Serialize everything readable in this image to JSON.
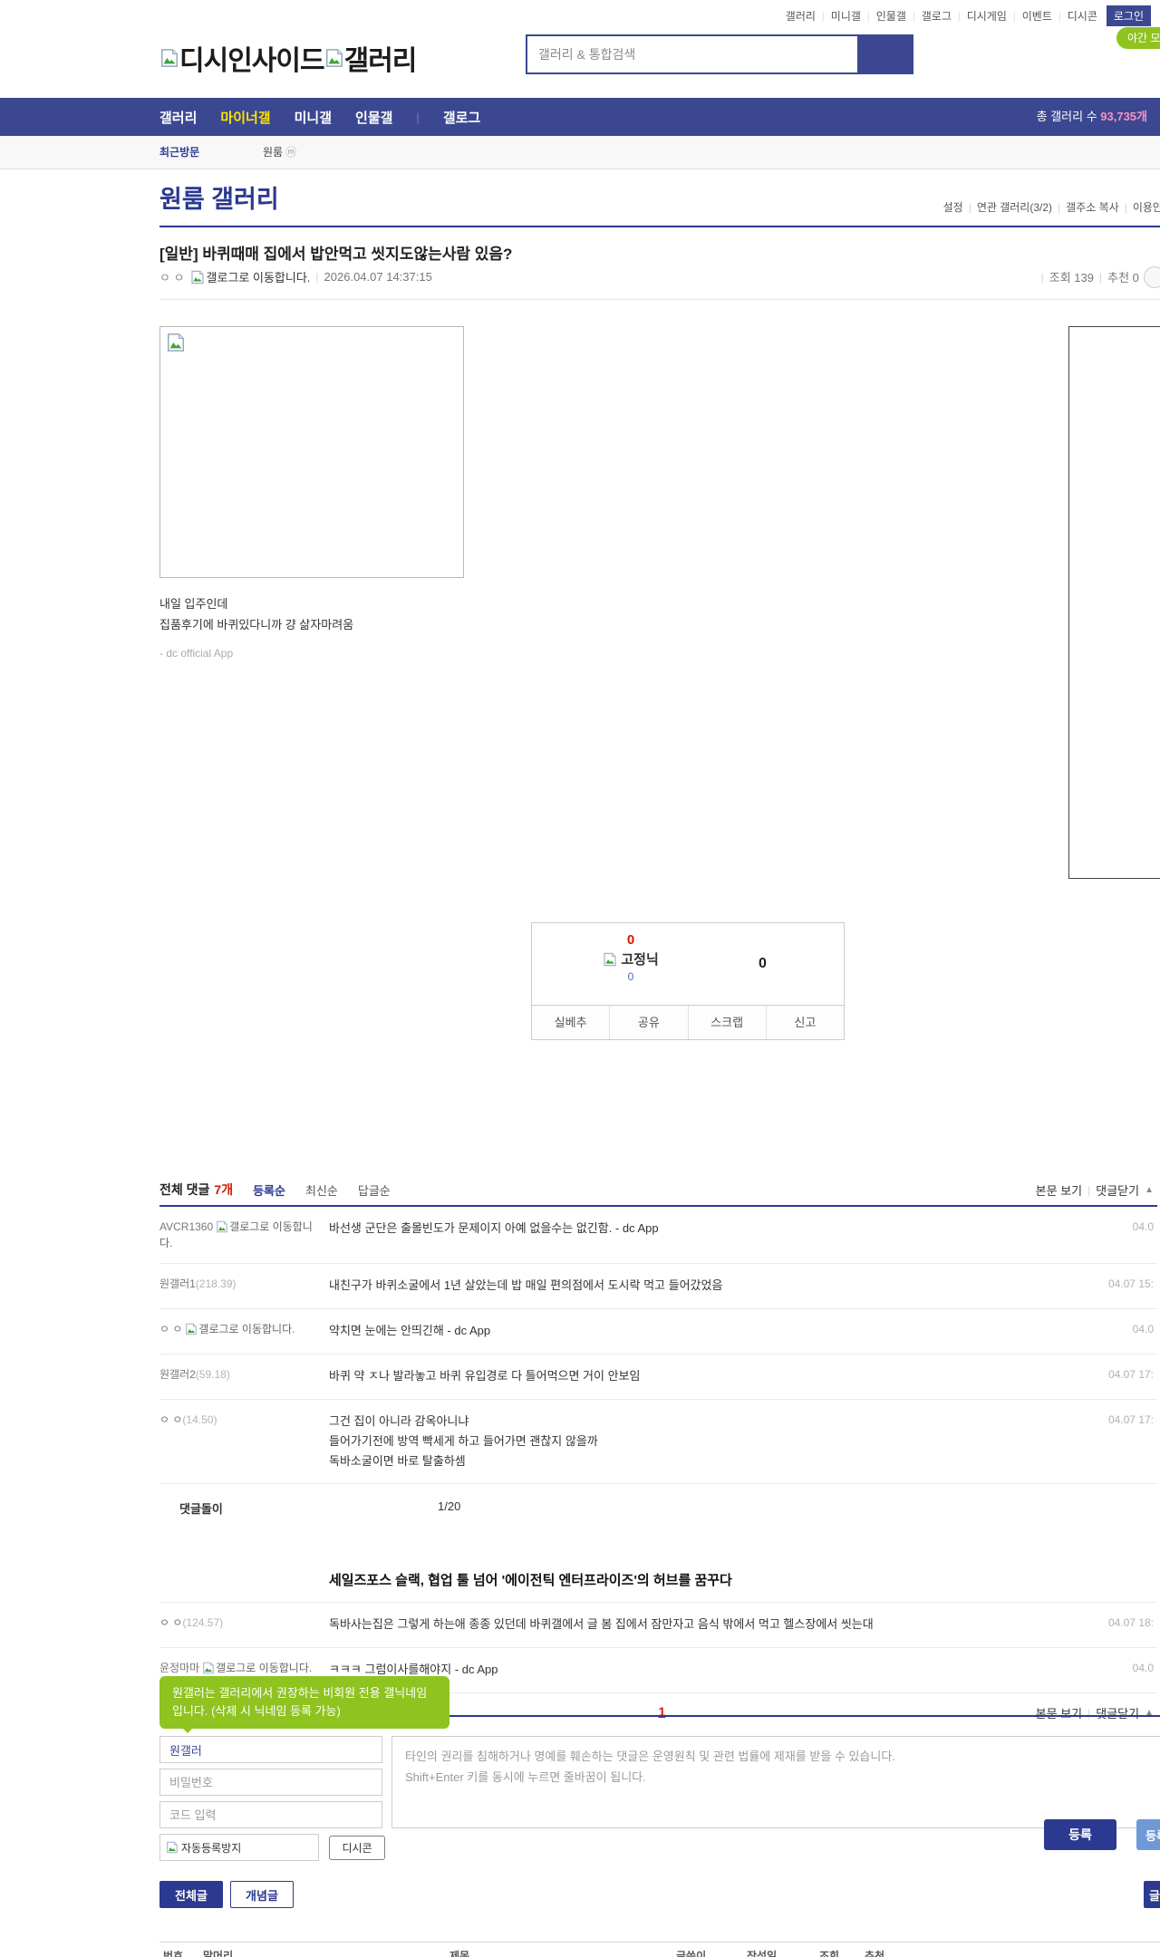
{
  "ui": {
    "sep": "|",
    "arrow_up": "▲",
    "m_badge": "ⓜ"
  },
  "colors": {
    "navy": "#3b4891",
    "navy_dark": "#2b3990",
    "red": "#d31900",
    "yellow": "#ffe400",
    "pink": "#ff8fc2",
    "green": "#8fc31f"
  },
  "topbar": {
    "links": [
      "갤러리",
      "미니갤",
      "인물갤",
      "갤로그",
      "디시게임",
      "이벤트",
      "디시콘"
    ],
    "login": "로그인",
    "night_mode": "야간 모드"
  },
  "header": {
    "logo_dcinside": "디시인사이드",
    "logo_gallery": "갤러리",
    "search_placeholder": "갤러리 & 통합검색"
  },
  "nav": {
    "items": [
      "갤러리",
      "마이너갤",
      "미니갤",
      "인물갤",
      "갤로그"
    ],
    "total_label": "총 갤러리 수 ",
    "total_count": "93,735개"
  },
  "visited": {
    "label": "최근방문",
    "item": "원룸"
  },
  "gallery": {
    "title": "원룸 갤러리",
    "links": [
      "설정",
      "연관 갤러리(3/2)",
      "갤주소 복사",
      "이용안내"
    ]
  },
  "post": {
    "title": "[일반] 바퀴때매 집에서 밥안먹고 씻지도않는사람 있음?",
    "author": "ㅇ ㅇ",
    "gallog_alt": "갤로그로 이동합니다.",
    "date": "2026.04.07 14:37:15",
    "views_label": "조회 139",
    "up_label": "추천 0",
    "body_line1": "내일 입주인데",
    "body_line2": "집품후기에 바퀴있다니까 걍 삶자마려움",
    "app_sign": "- dc official App"
  },
  "vote": {
    "up_count": "0",
    "fixed_label": "고정닉",
    "fixed_count": "0",
    "down_count": "0",
    "actions": [
      "실베추",
      "공유",
      "스크랩",
      "신고"
    ]
  },
  "comments": {
    "total_label": "전체 댓글",
    "count": "7개",
    "sorts": [
      "등록순",
      "최신순",
      "답글순"
    ],
    "view_post": "본문 보기",
    "close_label": "댓글닫기",
    "items": [
      {
        "author": "AVCR1360",
        "gallog_alt": "갤로그로 이동합니다.",
        "text": "바선생 군단은 출몰빈도가 문제이지 아예 없을수는 없긴함. - dc App",
        "date": "04.0"
      },
      {
        "author": "원갤러1",
        "ip": "(218.39)",
        "text": "내친구가 바퀴소굴에서 1년 살았는데 밥 매일 편의점에서 도시락 먹고 들어갔었음",
        "date": "04.07 15:"
      },
      {
        "author": "ㅇ ㅇ",
        "gallog_alt": "갤로그로 이동합니다.",
        "text": "약치면 눈에는 안띄긴해 - dc App",
        "date": "04.0"
      },
      {
        "author": "원갤러2",
        "ip": "(59.18)",
        "text": "바퀴 약 ㅈ나 발라놓고 바퀴 유입경로 다 틀어먹으면 거이 안보임",
        "date": "04.07 17:"
      },
      {
        "author": "ㅇ ㅇ",
        "ip": "(14.50)",
        "line1": "그건 집이 아니라 감옥아니냐",
        "line2": "들어가기전에 방역 빡세게 하고 들어가면 괜찮지 않을까",
        "line3": "독바소굴이면 바로 탈출하셈",
        "date": "04.07 17:"
      }
    ],
    "bot_row": {
      "name": "댓글돌이",
      "text": "1/20"
    },
    "ad_headline": "세일즈포스 슬랙, 협업 툴 넘어 '에이전틱 엔터프라이즈'의 허브를 꿈꾸다",
    "items2": [
      {
        "author": "ㅇ ㅇ",
        "ip": "(124.57)",
        "text": "독바사는집은 그렇게 하는애 종종 있던데 바퀴갤에서 글 봄 집에서 잠만자고 음식 밖에서 먹고 헬스장에서 씻는대",
        "date": "04.07 18:"
      },
      {
        "author": "윤정마마",
        "gallog_alt": "갤로그로 이동합니다.",
        "text": "ㅋㅋㅋ 그럼이사를해야지 - dc App",
        "date": "04.0"
      }
    ],
    "page": "1"
  },
  "form": {
    "tooltip": "원갤러는 갤러리에서 권장하는 비회원 전용 갤닉네임입니다. (삭제 시 닉네임 등록 가능)",
    "nickname_value": "원갤러",
    "password_placeholder": "비밀번호",
    "code_placeholder": "코드 입력",
    "captcha_alt": "자동등록방지",
    "dccon_button": "디시콘",
    "textarea_placeholder": "타인의 권리를 침해하거나 명예를 훼손하는 댓글은 운영원칙 및 관련 법률에 제재를 받을 수 있습니다.\nShift+Enter 키를 동시에 누르면 줄바꿈이 됩니다.",
    "submit": "등록",
    "submit2": "등록"
  },
  "bottom": {
    "all_posts": "전체글",
    "best_posts": "개념글",
    "write": "글쓰기",
    "list_header": [
      "번호",
      "말머리",
      "제목",
      "글쓴이",
      "작성일",
      "조회",
      "추천"
    ]
  }
}
